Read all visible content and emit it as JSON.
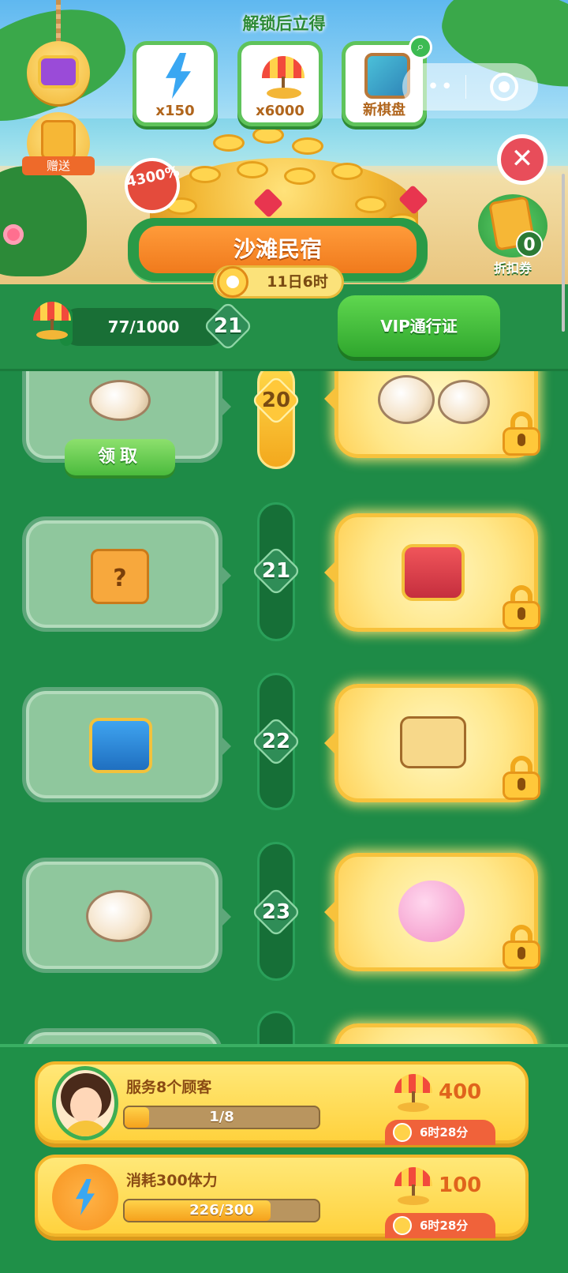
{
  "banner": {
    "unlock_title": "解锁后立得",
    "rewards": [
      {
        "label": "x150",
        "icon": "energy-bolt-icon"
      },
      {
        "label": "x6000",
        "icon": "beach-umbrella-icon"
      },
      {
        "label": "新棋盘",
        "icon": "new-board-icon"
      }
    ],
    "gift_label": "赠送",
    "bonus_badge": "4300%",
    "coupon": {
      "count": "0",
      "label": "折扣券"
    }
  },
  "title": {
    "name": "沙滩民宿",
    "timer": "11日6时"
  },
  "progress": {
    "text": "77/1000",
    "value": 77,
    "max": 1000,
    "level": "21",
    "vip_button": "VIP通行证"
  },
  "rows": [
    {
      "level": "20",
      "free_item": "grilled-fish-dish",
      "vip_item": "dessert-set",
      "claim": "领取",
      "track": "gold"
    },
    {
      "level": "21",
      "free_item": "mystery-box",
      "vip_item": "red-chest",
      "track": "dark"
    },
    {
      "level": "22",
      "free_item": "blue-chest",
      "vip_item": "flower-cake",
      "track": "dark"
    },
    {
      "level": "23",
      "free_item": "noodle-bowl",
      "vip_item": "piggy-bank",
      "track": "dark"
    }
  ],
  "tasks": [
    {
      "title": "服务8个顾客",
      "progress_text": "1/8",
      "progress": 0.125,
      "reward": "400",
      "time": "6时28分",
      "icon": "avatar"
    },
    {
      "title": "消耗300体力",
      "progress_text": "226/300",
      "progress": 0.753,
      "reward": "100",
      "time": "6时28分",
      "icon": "energy-bolt-icon"
    }
  ]
}
